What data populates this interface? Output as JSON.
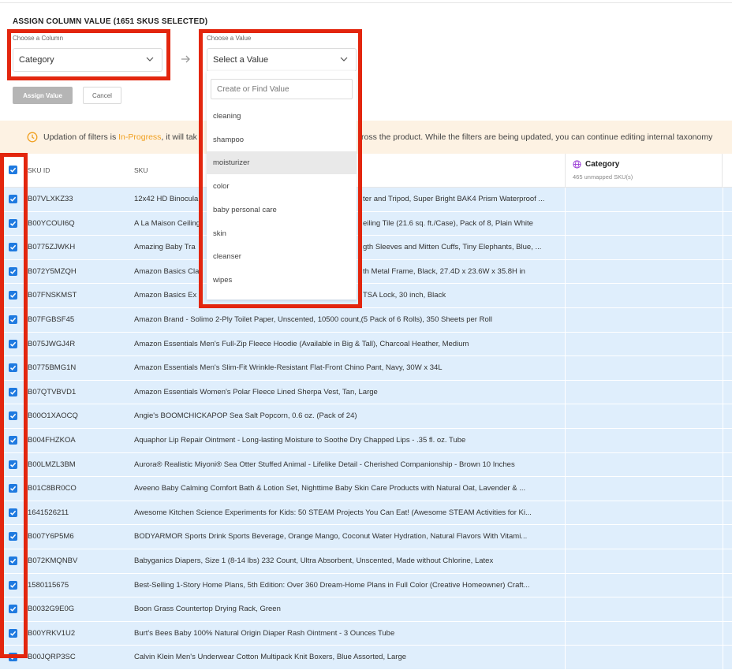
{
  "panel": {
    "title": "ASSIGN COLUMN VALUE (1651 SKUS SELECTED)",
    "column_label": "Choose a Column",
    "column_value": "Category",
    "value_label": "Choose a Value",
    "value_placeholder": "Select a Value",
    "assign_button": "Assign Value",
    "cancel_button": "Cancel"
  },
  "dropdown": {
    "search_placeholder": "Create or Find Value",
    "options": [
      "cleaning",
      "shampoo",
      "moisturizer",
      "color",
      "baby personal care",
      "skin",
      "cleanser",
      "wipes"
    ],
    "highlighted": "moisturizer"
  },
  "banner": {
    "text_before": "Updation of filters is ",
    "status": "In-Progress",
    "text_after": ", it will tak",
    "text_right": "ross the product. While the filters are being updated, you can continue editing internal taxonomy"
  },
  "table": {
    "headers": {
      "sku_id": "SKU ID",
      "sku": "SKU"
    },
    "category_column": {
      "title": "Category",
      "subtitle": "465 unmapped SKU(s)"
    },
    "rows": [
      {
        "id": "B07VLXKZ33",
        "name": "12x42 HD Binocular",
        "tail": "ter and Tripod, Super Bright BAK4 Prism Waterproof ..."
      },
      {
        "id": "B00YCOUI6Q",
        "name": "A La Maison Ceiling",
        "tail": "eiling Tile (21.6 sq. ft./Case), Pack of 8, Plain White"
      },
      {
        "id": "B0775ZJWKH",
        "name": "Amazing Baby Tra",
        "tail": "gth Sleeves and Mitten Cuffs, Tiny Elephants, Blue, ..."
      },
      {
        "id": "B072Y5MZQH",
        "name": "Amazon Basics Cla",
        "tail": "th Metal Frame, Black, 27.4D x 23.6W x 35.8H in"
      },
      {
        "id": "B07FNSKMST",
        "name": "Amazon Basics Ex",
        "tail": "TSA Lock, 30 inch, Black"
      },
      {
        "id": "B07FGBSF45",
        "name": "Amazon Brand - Solimo 2-Ply Toilet Paper, Unscented, 10500 count,(5 Pack of 6 Rolls), 350 Sheets per Roll",
        "tail": ""
      },
      {
        "id": "B075JWGJ4R",
        "name": "Amazon Essentials Men's Full-Zip Fleece Hoodie (Available in Big & Tall), Charcoal Heather, Medium",
        "tail": ""
      },
      {
        "id": "B0775BMG1N",
        "name": "Amazon Essentials Men's Slim-Fit Wrinkle-Resistant Flat-Front Chino Pant, Navy, 30W x 34L",
        "tail": ""
      },
      {
        "id": "B07QTVBVD1",
        "name": "Amazon Essentials Women's Polar Fleece Lined Sherpa Vest, Tan, Large",
        "tail": ""
      },
      {
        "id": "B00O1XAOCQ",
        "name": "Angie's BOOMCHICKAPOP Sea Salt Popcorn, 0.6 oz. (Pack of 24)",
        "tail": ""
      },
      {
        "id": "B004FHZKOA",
        "name": "Aquaphor Lip Repair Ointment - Long-lasting Moisture to Soothe Dry Chapped Lips - .35 fl. oz. Tube",
        "tail": ""
      },
      {
        "id": "B00LMZL3BM",
        "name": "Aurora® Realistic Miyoni® Sea Otter Stuffed Animal - Lifelike Detail - Cherished Companionship - Brown 10 Inches",
        "tail": ""
      },
      {
        "id": "B01C8BR0CO",
        "name": "Aveeno Baby Calming Comfort Bath & Lotion Set, Nighttime Baby Skin Care Products with Natural Oat, Lavender & ...",
        "tail": ""
      },
      {
        "id": "1641526211",
        "name": "Awesome Kitchen Science Experiments for Kids: 50 STEAM Projects You Can Eat! (Awesome STEAM Activities for Ki...",
        "tail": ""
      },
      {
        "id": "B007Y6P5M6",
        "name": "BODYARMOR Sports Drink Sports Beverage, Orange Mango, Coconut Water Hydration, Natural Flavors With Vitami...",
        "tail": ""
      },
      {
        "id": "B072KMQNBV",
        "name": "Babyganics Diapers, Size 1 (8-14 lbs) 232 Count, Ultra Absorbent, Unscented, Made without Chlorine, Latex",
        "tail": ""
      },
      {
        "id": "1580115675",
        "name": "Best-Selling 1-Story Home Plans, 5th Edition: Over 360 Dream-Home Plans in Full Color (Creative Homeowner) Craft...",
        "tail": ""
      },
      {
        "id": "B0032G9E0G",
        "name": "Boon Grass Countertop Drying Rack, Green",
        "tail": ""
      },
      {
        "id": "B00YRKV1U2",
        "name": "Burt's Bees Baby 100% Natural Origin Diaper Rash Ointment - 3 Ounces Tube",
        "tail": ""
      },
      {
        "id": "B00JQRP3SC",
        "name": "Calvin Klein Men's Underwear Cotton Multipack Knit Boxers, Blue Assorted, Large",
        "tail": ""
      }
    ]
  },
  "colors": {
    "accent": "#1f7ae0",
    "highlight_box": "#e3260e",
    "row_bg": "#dfeefc",
    "banner_bg": "#fdf2e3",
    "status": "#f0a020",
    "category_icon": "#9b3fd6"
  }
}
